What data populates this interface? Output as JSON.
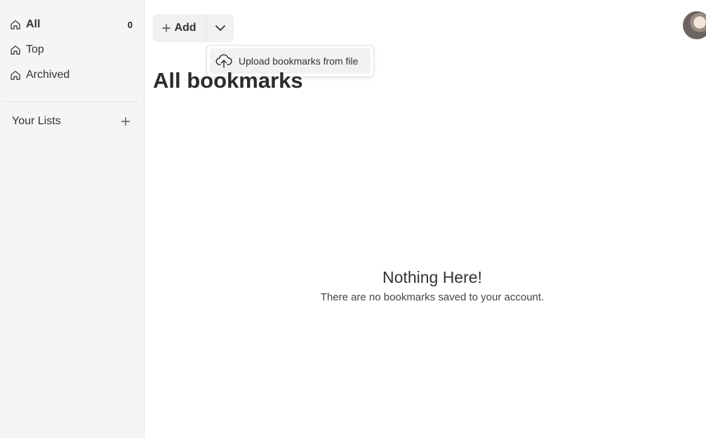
{
  "sidebar": {
    "items": [
      {
        "label": "All",
        "count": "0",
        "icon": "home-icon"
      },
      {
        "label": "Top",
        "icon": "home-icon"
      },
      {
        "label": "Archived",
        "icon": "home-icon"
      }
    ],
    "lists_title": "Your Lists"
  },
  "toolbar": {
    "add_label": "Add"
  },
  "menu": {
    "upload_label": "Upload bookmarks from file"
  },
  "main": {
    "title": "All bookmarks",
    "empty_title": "Nothing Here!",
    "empty_subtitle": "There are no bookmarks saved to your account."
  }
}
